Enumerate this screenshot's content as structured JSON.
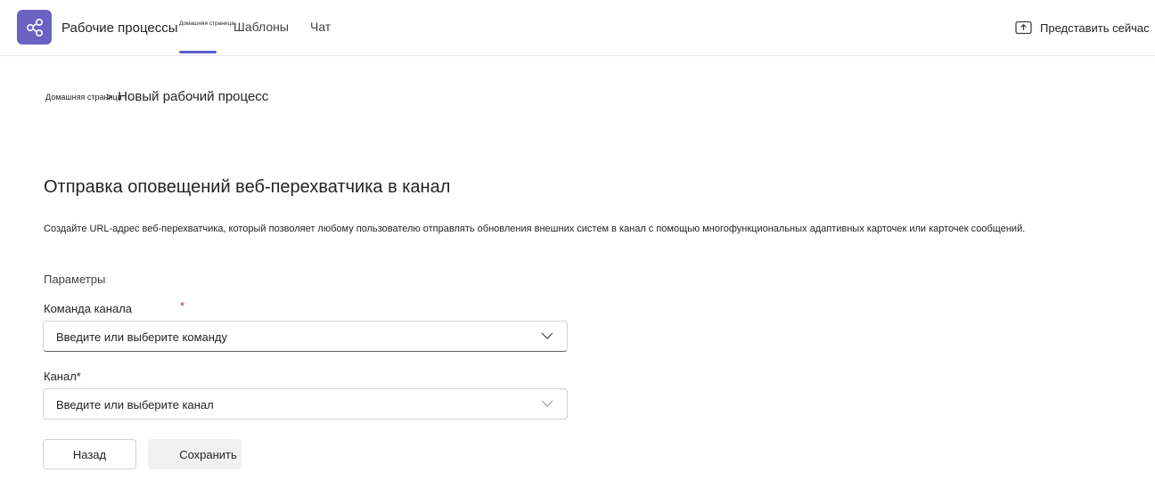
{
  "app": {
    "title": "Рабочие процессы",
    "accent_color": "#6b63c4",
    "logo_icon": "workflow-share-icon"
  },
  "nav": {
    "tabs": [
      {
        "label": "Домашняя страница",
        "active": true
      },
      {
        "label": "Шаблоны",
        "active": false
      },
      {
        "label": "Чат",
        "active": false
      }
    ],
    "underline_color": "#5b5fc7"
  },
  "present": {
    "label": "Представить сейчас",
    "icon": "share-screen-icon"
  },
  "breadcrumb": {
    "home": "Домашняя страница",
    "separator": ">",
    "current": "Новый рабочий процесс"
  },
  "page": {
    "title": "Отправка оповещений веб-перехватчика в канал",
    "description": "Создайте URL-адрес веб-перехватчика, который позволяет любому пользователю отправлять обновления внешних систем в канал с помощью многофункциональных адаптивных карточек или карточек сообщений."
  },
  "form": {
    "section_label": "Параметры",
    "team": {
      "label": "Команда канала",
      "required_mark": "*",
      "placeholder": "Введите или выберите команду"
    },
    "channel": {
      "label": "Канал*",
      "placeholder": "Введите или выберите канал"
    }
  },
  "buttons": {
    "back": "Назад",
    "save": "Сохранить"
  }
}
